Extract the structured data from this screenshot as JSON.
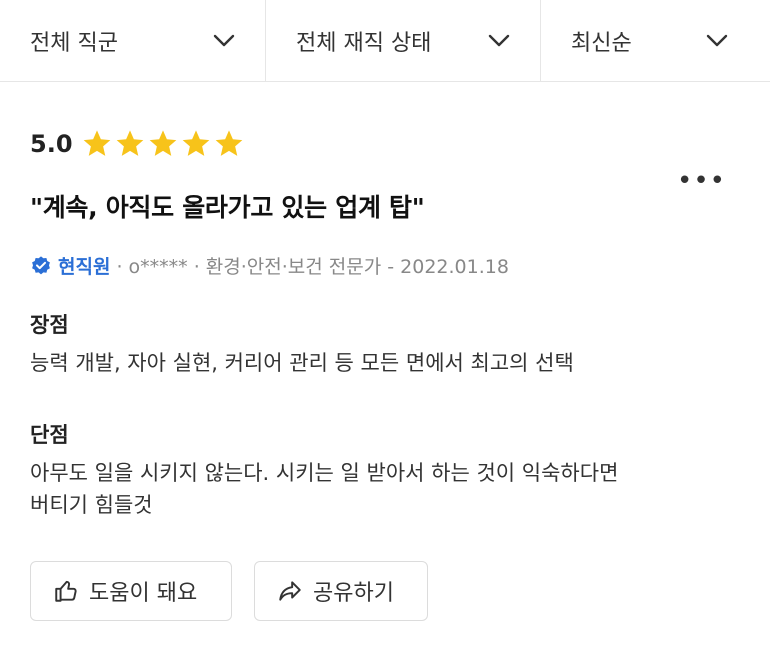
{
  "filters": {
    "job": "전체 직군",
    "status": "전체 재직 상태",
    "sort": "최신순"
  },
  "review": {
    "score": "5.0",
    "stars": 5,
    "star_color": "#f7c31a",
    "title": "\"계속, 아직도 올라가고 있는 업계 탑\"",
    "badge_label": "현직원",
    "meta_text": "· o***** · 환경·안전·보건 전문가 - 2022.01.18",
    "badge_color": "#2b6fd6",
    "pros_heading": "장점",
    "pros_text": "능력 개발, 자아 실현, 커리어 관리 등 모든 면에서 최고의 선택",
    "cons_heading": "단점",
    "cons_line1": "아무도 일을 시키지 않는다. 시키는 일 받아서 하는 것이 익숙하다면",
    "cons_line2": "버티기 힘들것",
    "more_icon": "more-icon"
  },
  "actions": {
    "helpful": "도움이 돼요",
    "share": "공유하기"
  }
}
